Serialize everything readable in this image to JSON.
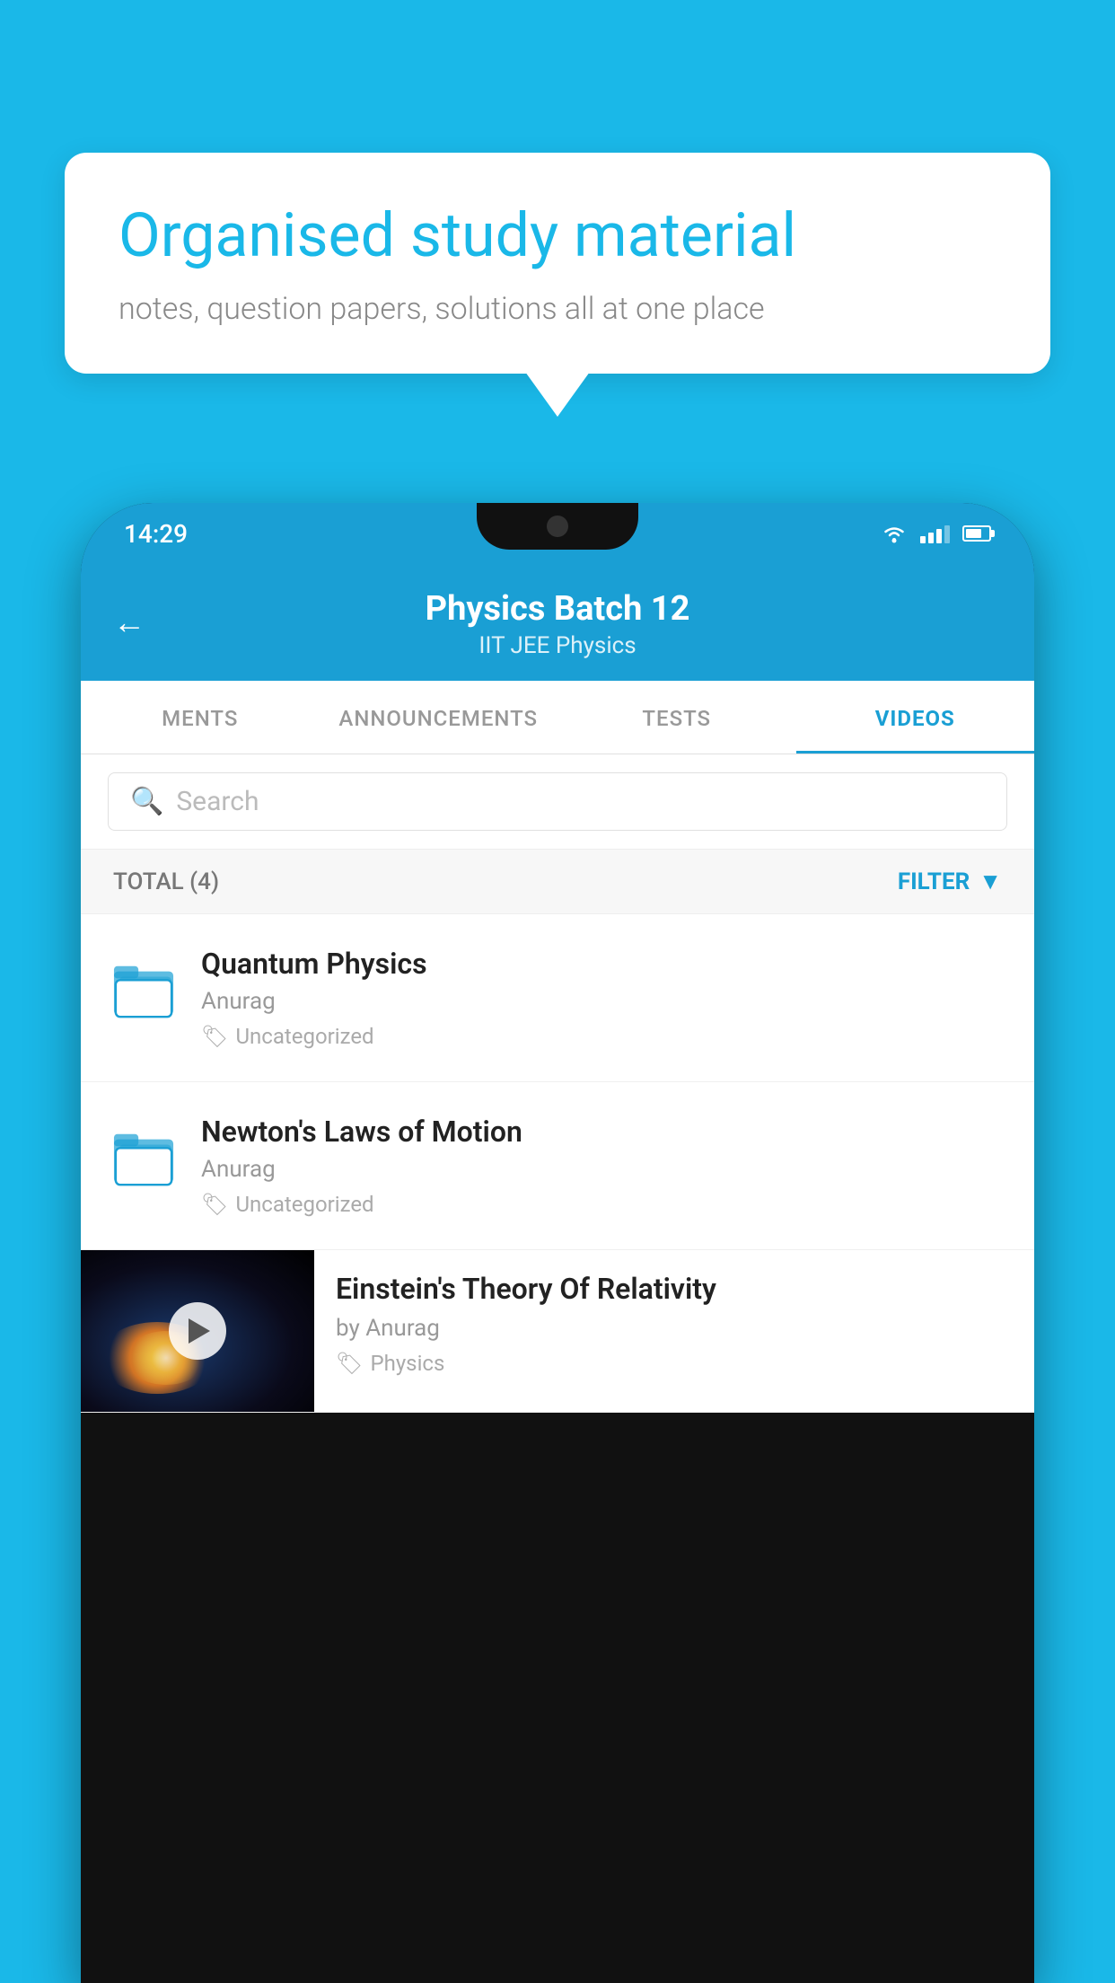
{
  "background": {
    "color": "#1ab8e8"
  },
  "speech_bubble": {
    "title": "Organised study material",
    "subtitle": "notes, question papers, solutions all at one place"
  },
  "phone": {
    "status_bar": {
      "time": "14:29"
    },
    "app_header": {
      "title": "Physics Batch 12",
      "subtitle": "IIT JEE   Physics",
      "back_label": "←"
    },
    "tabs": [
      {
        "label": "MENTS",
        "active": false
      },
      {
        "label": "ANNOUNCEMENTS",
        "active": false
      },
      {
        "label": "TESTS",
        "active": false
      },
      {
        "label": "VIDEOS",
        "active": true
      }
    ],
    "search": {
      "placeholder": "Search"
    },
    "filter": {
      "total_label": "TOTAL (4)",
      "filter_label": "FILTER"
    },
    "videos": [
      {
        "id": 1,
        "title": "Quantum Physics",
        "author": "Anurag",
        "tag": "Uncategorized",
        "has_thumbnail": false
      },
      {
        "id": 2,
        "title": "Newton's Laws of Motion",
        "author": "Anurag",
        "tag": "Uncategorized",
        "has_thumbnail": false
      },
      {
        "id": 3,
        "title": "Einstein's Theory Of Relativity",
        "author": "by Anurag",
        "tag": "Physics",
        "has_thumbnail": true
      }
    ]
  }
}
